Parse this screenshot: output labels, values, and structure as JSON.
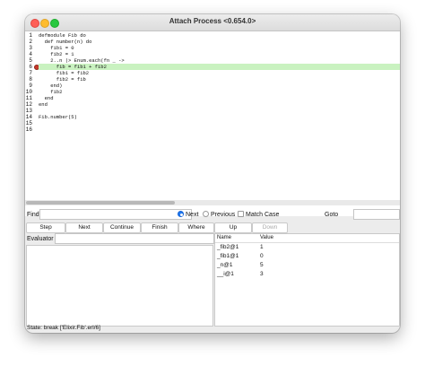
{
  "window": {
    "title": "Attach Process <0.654.0>"
  },
  "editor": {
    "line_numbers": [
      "1",
      "2",
      "3",
      "4",
      "5",
      "6",
      "7",
      "8",
      "9",
      "10",
      "11",
      "12",
      "13",
      "14",
      "15",
      "16"
    ],
    "lines": [
      "defmodule Fib do",
      "  def number(n) do",
      "    fib1 = 0",
      "    fib2 = 1",
      "    2..n |> Enum.each(fn _ ->",
      "      fib = fib1 + fib2",
      "      fib1 = fib2",
      "      fib2 = fib",
      "    end)",
      "    fib2",
      "  end",
      "end",
      "",
      "Fib.number(5)",
      "",
      ""
    ],
    "highlighted_line": 6,
    "breakpoint_line": 6
  },
  "find": {
    "label": "Find:",
    "value": "",
    "options": [
      "Next",
      "Previous",
      "Match Case"
    ],
    "selected": "Next",
    "goto_label": "Goto",
    "goto_value": ""
  },
  "toolbar": {
    "buttons": [
      "Step",
      "Next",
      "Continue",
      "Finish",
      "Where",
      "Up",
      "Down"
    ],
    "disabled": [
      "Down"
    ]
  },
  "evaluator": {
    "label": "Evaluator",
    "value": ""
  },
  "bindings": {
    "headers": [
      "Name",
      "Value"
    ],
    "rows": [
      {
        "name": "_fib2@1",
        "value": "1"
      },
      {
        "name": "_fib1@1",
        "value": "0"
      },
      {
        "name": "_n@1",
        "value": "5"
      },
      {
        "name": "__i@1",
        "value": "3"
      }
    ]
  },
  "status": {
    "text": "State: break ['Elixir.Fib'.erl/6]"
  },
  "colors": {
    "highlight": "#c9f2c0",
    "breakpoint": "#c73a2a",
    "radio_selected": "#1f78f0"
  }
}
